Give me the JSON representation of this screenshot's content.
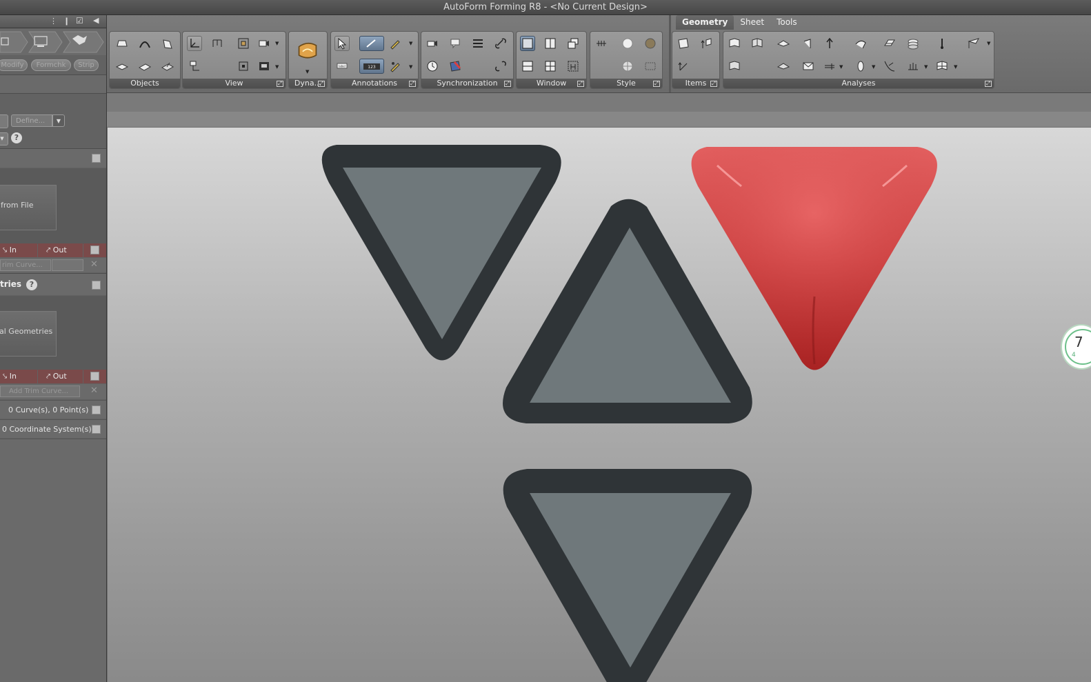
{
  "window": {
    "title": "AutoForm Forming R8 - <No Current Design>"
  },
  "ribbon": {
    "tabs": [
      {
        "label": "Geometry",
        "active": true
      },
      {
        "label": "Sheet",
        "active": false
      },
      {
        "label": "Tools",
        "active": false
      }
    ],
    "groups": {
      "objects": "Objects",
      "view": "View",
      "dyna": "Dyna...",
      "annotations": "Annotations",
      "synchronization": "Synchronization",
      "window": "Window",
      "style": "Style",
      "items": "Items",
      "analyses": "Analyses"
    },
    "label_icon_text": "label",
    "counter_icon_text": "123"
  },
  "left_panel": {
    "process_buttons": [
      "Modify",
      "Formchk",
      "Strip"
    ],
    "define_dropdown": "Define...",
    "from_file_label": "from File",
    "in_label": "In",
    "out_label": "Out",
    "trim_curve_dropdown_1": "rim Curve...",
    "section_title": "tries",
    "geometries_label": "al Geometries",
    "in_label_2": "In",
    "out_label_2": "Out",
    "trim_curve_dropdown_2": "Add Trim Curve...",
    "curve_count": "0 Curve(s), 0 Point(s)",
    "coord_count": "0 Coordinate System(s)"
  },
  "viewport": {
    "colors": {
      "dark_triangle": "#2f3437",
      "triangle_fill": "#6f787b",
      "red_triangle": "#cc3b3b"
    },
    "nav_cube_text": "7",
    "nav_cube_sub": "4"
  }
}
